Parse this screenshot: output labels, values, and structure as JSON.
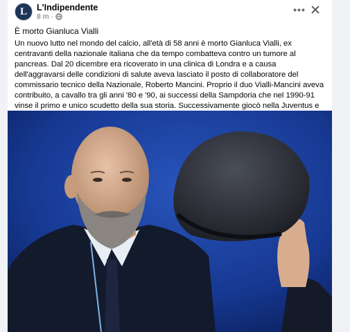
{
  "post": {
    "page_name": "L'Indipendente",
    "avatar_letter": "L",
    "time": "8 m",
    "separator": "·",
    "title": "È morto Gianluca Vialli",
    "body": "Un nuovo lutto nel mondo del calcio, all'età di 58 anni è morto Gianluca Vialli, ex centravanti della nazionale italiana che da tempo combatteva contro un tumore al pancreas. Dal 20 dicembre era ricoverato in una clinica di Londra e a causa dell'aggravarsi delle condizioni di salute aveva lasciato il posto di collaboratore del commissario tecnico della Nazionale, Roberto Mancini. Proprio il duo Vialli-Mancini aveva contribuito, a cavallo tra gli anni '80 e '90, ai successi della Sampdoria che nel 1990-91 vinse il primo e unico scudetto della sua storia. Successivamente giocò nella Juventus e nel Chelsea, diventandone anche allenatore."
  },
  "icons": {
    "more": "more-options-icon",
    "close": "close-icon",
    "audience": "globe-icon"
  },
  "colors": {
    "photo_background": "#1a3fa0",
    "text": "#050505",
    "secondary_text": "#65676b"
  }
}
